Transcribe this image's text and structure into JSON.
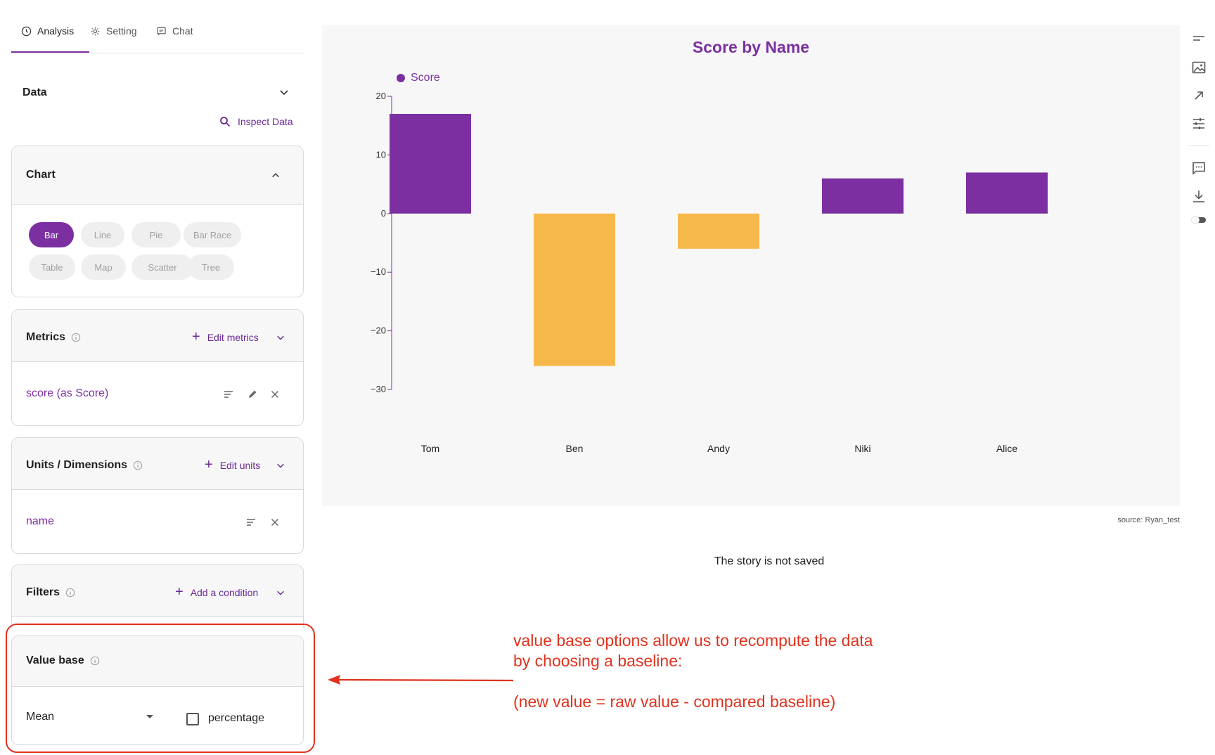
{
  "tabs": [
    {
      "label": "Analysis",
      "icon": "clock-icon",
      "active": true
    },
    {
      "label": "Setting",
      "icon": "gear-icon",
      "active": false
    },
    {
      "label": "Chat",
      "icon": "chat-icon",
      "active": false
    }
  ],
  "data_section": {
    "title": "Data",
    "inspect_label": "Inspect Data"
  },
  "chart_card": {
    "title": "Chart",
    "types": [
      "Bar",
      "Line",
      "Pie",
      "Bar Race",
      "Table",
      "Map",
      "Scatter",
      "Tree"
    ],
    "selected": "Bar"
  },
  "metrics_card": {
    "title": "Metrics",
    "action": "Edit metrics",
    "items": [
      "score (as Score)"
    ]
  },
  "units_card": {
    "title": "Units / Dimensions",
    "action": "Edit units",
    "items": [
      "name"
    ]
  },
  "filters_card": {
    "title": "Filters",
    "action": "Add a condition"
  },
  "value_base_card": {
    "title": "Value base",
    "selected": "Mean",
    "checkbox_label": "percentage",
    "checkbox_checked": false
  },
  "chart_data": {
    "type": "bar",
    "title": "Score by Name",
    "categories": [
      "Tom",
      "Ben",
      "Andy",
      "Niki",
      "Alice"
    ],
    "series": [
      {
        "name": "Score",
        "values": [
          17,
          -26,
          -6,
          6,
          7
        ]
      }
    ],
    "ylim": [
      -30,
      20
    ],
    "yticks": [
      "20",
      "10",
      "0",
      "−10",
      "−20",
      "−30"
    ],
    "colors": {
      "positive": "#7b2fa0",
      "negative": "#f7b84b"
    },
    "legend_position": "top-left"
  },
  "source_text": "source: Ryan_test",
  "story_status": "The story is not saved",
  "toolbar": [
    "sort-icon",
    "image-icon",
    "expand-icon",
    "sliders-icon",
    "comment-icon",
    "download-icon",
    "toggle"
  ],
  "annotation": {
    "lines": [
      "value base options allow us to recompute the data",
      "by choosing a baseline:",
      "",
      "(new value = raw value - compared baseline)"
    ],
    "color": "#e0321e"
  },
  "accent_color": "#7b2fa0"
}
